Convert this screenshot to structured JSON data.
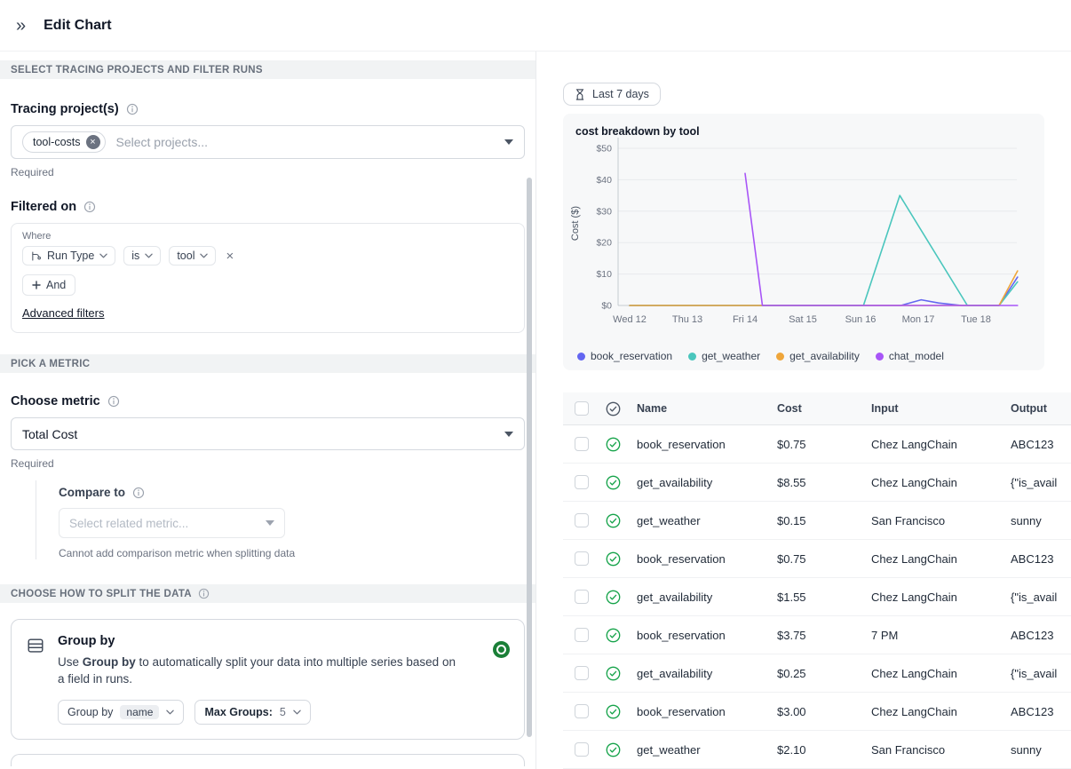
{
  "header": {
    "title": "Edit Chart"
  },
  "colors": {
    "radio_selected": "#1a7f37",
    "status_success": "#16a34a",
    "status_header": "#4b5563"
  },
  "icons": {
    "collapse": "double-chevron-right",
    "info": "info-circle",
    "time_range": "hourglass",
    "run_type": "flow-branch",
    "group_by": "table-rows",
    "status": "check-circle",
    "remove": "x-mark"
  },
  "sections": {
    "projects": "SELECT TRACING PROJECTS AND FILTER RUNS",
    "metric": "PICK A METRIC",
    "split": "CHOOSE HOW TO SPLIT THE DATA"
  },
  "tracing": {
    "label": "Tracing project(s)",
    "selected_project": "tool-costs",
    "placeholder": "Select projects...",
    "required": "Required"
  },
  "filters": {
    "label": "Filtered on",
    "where": "Where",
    "field": "Run Type",
    "operator": "is",
    "value": "tool",
    "and": "And",
    "advanced": "Advanced filters"
  },
  "metric": {
    "label": "Choose metric",
    "selected": "Total Cost",
    "required": "Required",
    "compare_label": "Compare to",
    "compare_placeholder": "Select related metric...",
    "compare_note": "Cannot add comparison metric when splitting data"
  },
  "split": {
    "title": "Group by",
    "desc_prefix": "Use ",
    "desc_bold": "Group by",
    "desc_suffix": " to automatically split your data into multiple series based on a field in runs.",
    "group_by_label": "Group by",
    "group_by_value": "name",
    "max_groups_label": "Max Groups:",
    "max_groups_value": "5"
  },
  "time_range": {
    "label": "Last 7 days"
  },
  "chart_data": {
    "type": "line",
    "title": "cost breakdown by tool",
    "ylabel": "Cost ($)",
    "ylim": [
      0,
      50
    ],
    "y_ticks": [
      "$0",
      "$10",
      "$20",
      "$30",
      "$40",
      "$50"
    ],
    "x_ticks": [
      "Wed 12",
      "Thu 13",
      "Fri 14",
      "Sat 15",
      "Sun 16",
      "Mon 17",
      "Tue 18"
    ],
    "grid": true,
    "legend_position": "bottom",
    "series": [
      {
        "name": "book_reservation",
        "color": "#6366f1",
        "points": [
          [
            0,
            0
          ],
          [
            4.7,
            0
          ],
          [
            5.05,
            1.8
          ],
          [
            5.35,
            0.8
          ],
          [
            5.75,
            0
          ],
          [
            6.4,
            0
          ],
          [
            6.72,
            9
          ]
        ]
      },
      {
        "name": "get_weather",
        "color": "#4ac6bd",
        "points": [
          [
            0,
            0
          ],
          [
            4.05,
            0
          ],
          [
            4.68,
            35
          ],
          [
            5.85,
            0
          ],
          [
            6.4,
            0
          ],
          [
            6.72,
            7.5
          ]
        ]
      },
      {
        "name": "get_availability",
        "color": "#efa63b",
        "points": [
          [
            0,
            0
          ],
          [
            6.4,
            0
          ],
          [
            6.72,
            11
          ]
        ]
      },
      {
        "name": "chat_model",
        "color": "#a855f7",
        "points": [
          [
            2,
            42
          ],
          [
            2.3,
            0
          ],
          [
            6.72,
            0
          ]
        ]
      }
    ]
  },
  "table": {
    "columns": [
      "Name",
      "Cost",
      "Input",
      "Output"
    ],
    "rows": [
      {
        "name": "book_reservation",
        "cost": "$0.75",
        "input": "Chez LangChain",
        "output": "ABC123"
      },
      {
        "name": "get_availability",
        "cost": "$8.55",
        "input": "Chez LangChain",
        "output": "{\"is_avail"
      },
      {
        "name": "get_weather",
        "cost": "$0.15",
        "input": "San Francisco",
        "output": "sunny"
      },
      {
        "name": "book_reservation",
        "cost": "$0.75",
        "input": "Chez LangChain",
        "output": "ABC123"
      },
      {
        "name": "get_availability",
        "cost": "$1.55",
        "input": "Chez LangChain",
        "output": "{\"is_avail"
      },
      {
        "name": "book_reservation",
        "cost": "$3.75",
        "input": "7 PM",
        "output": "ABC123"
      },
      {
        "name": "get_availability",
        "cost": "$0.25",
        "input": "Chez LangChain",
        "output": "{\"is_avail"
      },
      {
        "name": "book_reservation",
        "cost": "$3.00",
        "input": "Chez LangChain",
        "output": "ABC123"
      },
      {
        "name": "get_weather",
        "cost": "$2.10",
        "input": "San Francisco",
        "output": "sunny"
      }
    ]
  }
}
